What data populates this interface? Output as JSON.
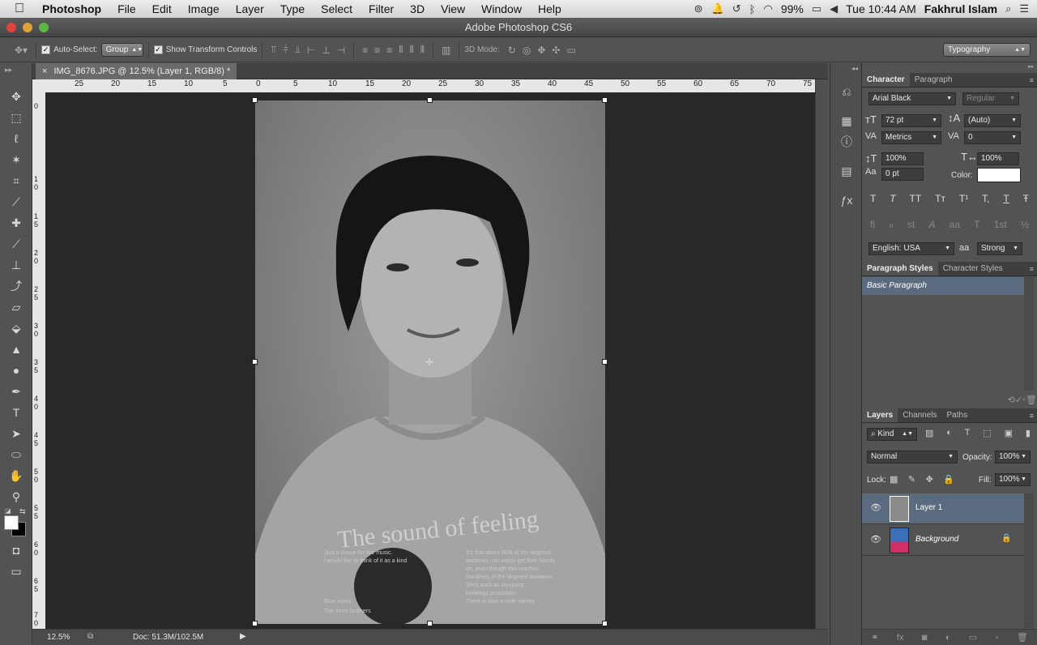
{
  "menubar": {
    "apple": "",
    "app": "Photoshop",
    "items": [
      "File",
      "Edit",
      "Image",
      "Layer",
      "Type",
      "Select",
      "Filter",
      "3D",
      "View",
      "Window",
      "Help"
    ],
    "battery": "99%",
    "clock": "Tue 10:44 AM",
    "user": "Fakhrul Islam"
  },
  "window": {
    "title": "Adobe Photoshop CS6"
  },
  "options": {
    "auto_select_label": "Auto-Select:",
    "auto_select_value": "Group",
    "show_transform_label": "Show Transform Controls",
    "mode_3d_label": "3D Mode:",
    "workspace": "Typography"
  },
  "document": {
    "tab_title": "IMG_8676.JPG @ 12.5% (Layer 1, RGB/8) *",
    "close": "×"
  },
  "hruler_ticks": [
    "25",
    "20",
    "15",
    "10",
    "5",
    "0",
    "5",
    "10",
    "15",
    "20",
    "25",
    "30",
    "35",
    "40",
    "45",
    "50",
    "55",
    "60",
    "65",
    "70",
    "75"
  ],
  "vruler_ticks": [
    "0",
    "1 0",
    "1 5",
    "2 0",
    "2 5",
    "3 0",
    "3 5",
    "4 0",
    "4 5",
    "5 0",
    "5 5",
    "6 0",
    "6 5",
    "7 0"
  ],
  "status": {
    "zoom": "12.5%",
    "doc": "Doc: 51.3M/102.5M"
  },
  "character": {
    "tabs": [
      "Character",
      "Paragraph"
    ],
    "font": "Arial Black",
    "style": "Regular",
    "size": "72 pt",
    "leading": "(Auto)",
    "kerning": "Metrics",
    "tracking": "0",
    "vscale": "100%",
    "hscale": "100%",
    "baseline": "0 pt",
    "color_label": "Color:",
    "glyphs1": [
      "T",
      "T",
      "TT",
      "Tт",
      "T¹",
      "T,",
      "T",
      "Ŧ"
    ],
    "glyphs2": [
      "fi",
      "ℴ",
      "st",
      "A",
      "aa",
      "T",
      "1st",
      "½"
    ],
    "language": "English: USA",
    "aa_label": "aa",
    "antialias": "Strong"
  },
  "paragraph_styles": {
    "tabs": [
      "Paragraph Styles",
      "Character Styles"
    ],
    "items": [
      "Basic Paragraph"
    ]
  },
  "layers": {
    "tabs": [
      "Layers",
      "Channels",
      "Paths"
    ],
    "kind": "Kind",
    "blend": "Normal",
    "opacity_label": "Opacity:",
    "opacity": "100%",
    "lock_label": "Lock:",
    "fill_label": "Fill:",
    "fill": "100%",
    "items": [
      {
        "name": "Layer 1"
      },
      {
        "name": "Background"
      }
    ]
  }
}
